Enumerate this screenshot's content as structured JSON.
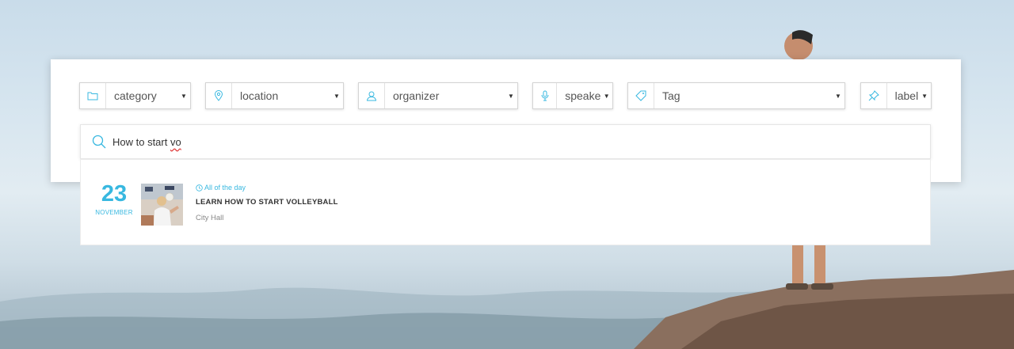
{
  "filters": [
    {
      "id": "category",
      "label": "category",
      "icon": "folder-icon"
    },
    {
      "id": "location",
      "label": "location",
      "icon": "location-pin-icon"
    },
    {
      "id": "organizer",
      "label": "organizer",
      "icon": "user-icon"
    },
    {
      "id": "speaker",
      "label": "speake",
      "icon": "microphone-icon"
    },
    {
      "id": "tag",
      "label": "Tag",
      "icon": "tag-icon"
    },
    {
      "id": "label",
      "label": "label",
      "icon": "pin-icon"
    }
  ],
  "search": {
    "prefix": "How to start ",
    "misspelled": "vo",
    "icon": "search-icon"
  },
  "event": {
    "day": "23",
    "month": "NOVEMBER",
    "time": "All of the day",
    "title": "LEARN HOW TO START VOLLEYBALL",
    "venue": "City Hall",
    "thumbnail": "volleyball-photo"
  },
  "colors": {
    "accent": "#38b8e0",
    "text": "#333333",
    "muted": "#888888"
  }
}
